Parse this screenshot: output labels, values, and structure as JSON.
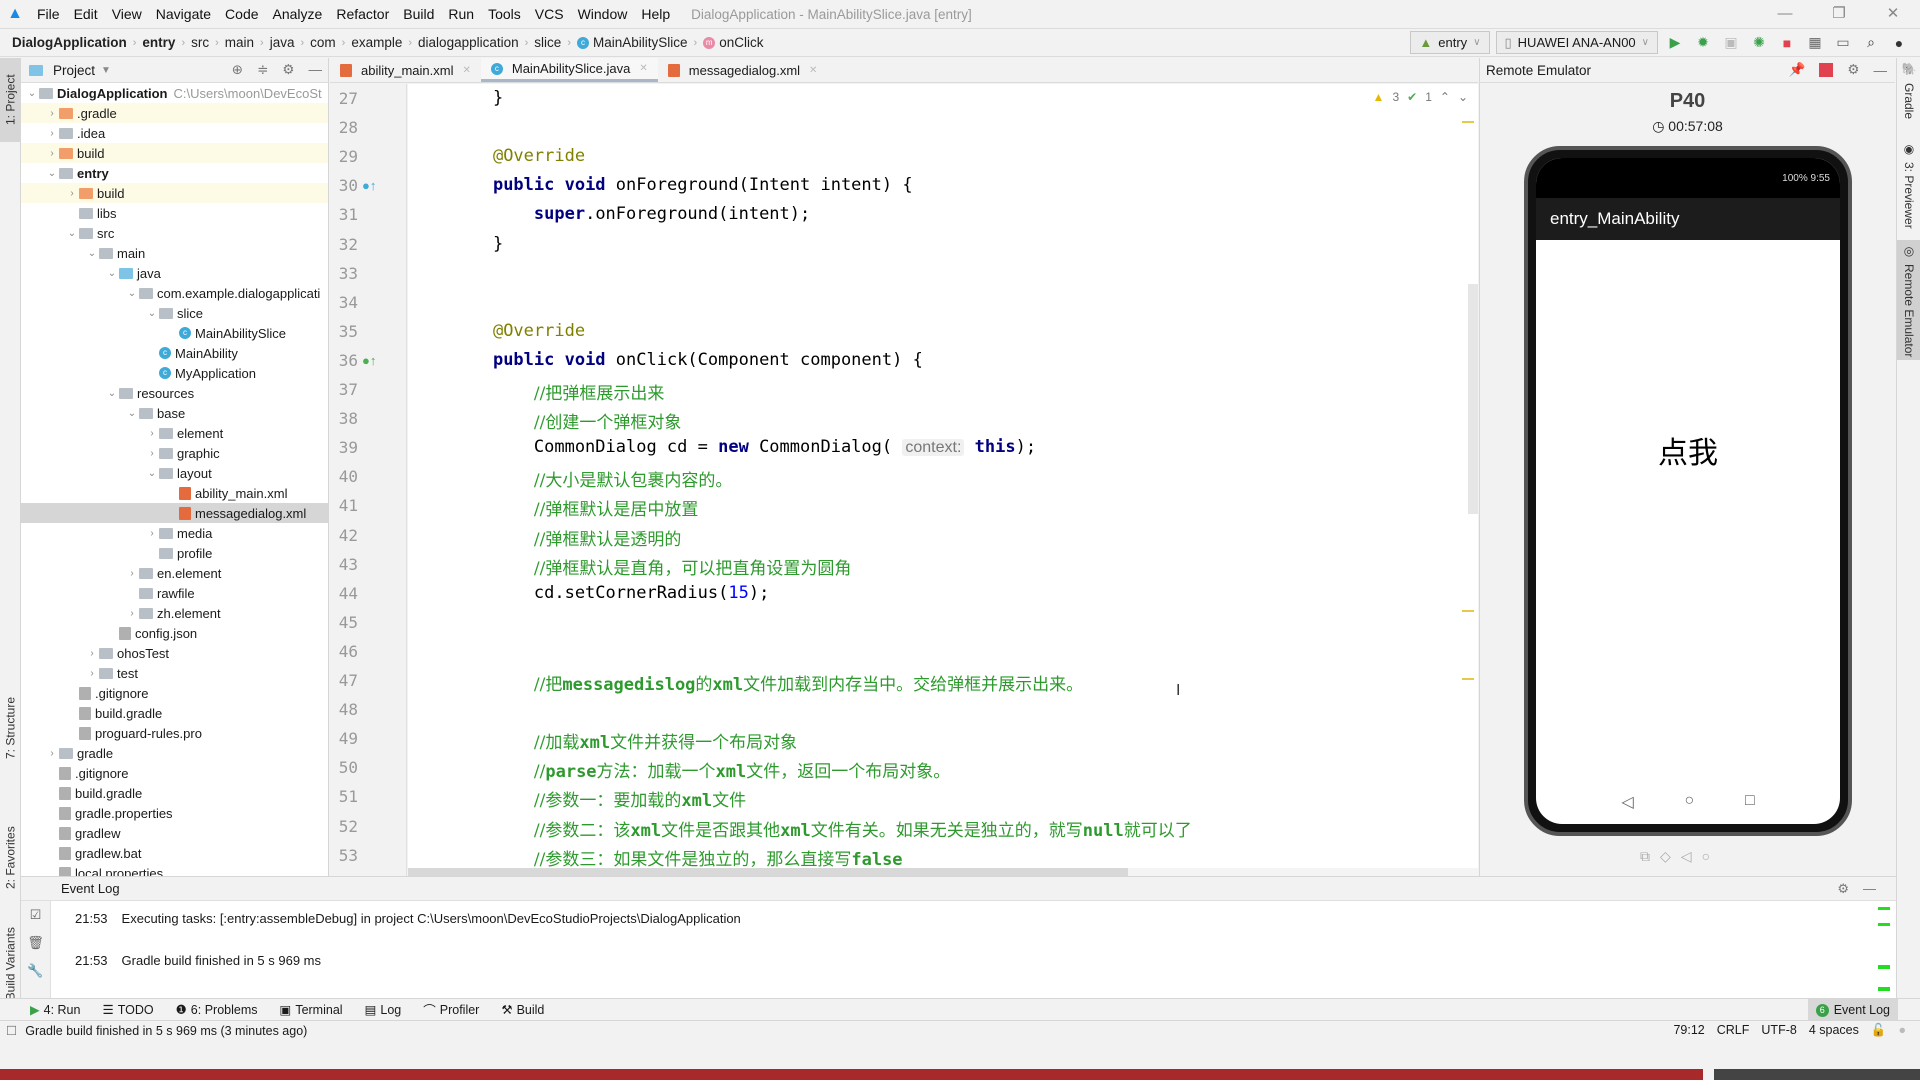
{
  "menu": {
    "items": [
      "File",
      "Edit",
      "View",
      "Navigate",
      "Code",
      "Analyze",
      "Refactor",
      "Build",
      "Run",
      "Tools",
      "VCS",
      "Window",
      "Help"
    ],
    "window_title": "DialogApplication - MainAbilitySlice.java [entry]"
  },
  "breadcrumb": [
    "DialogApplication",
    "entry",
    "src",
    "main",
    "java",
    "com",
    "example",
    "dialogapplication",
    "slice",
    "MainAbilitySlice",
    "onClick"
  ],
  "toolbar": {
    "config": "entry",
    "device": "HUAWEI ANA-AN00"
  },
  "project_panel": {
    "title": "Project",
    "tree": [
      {
        "label": "DialogApplication",
        "extra": "C:\\Users\\moon\\DevEcoSt",
        "depth": 0,
        "arrow": "v",
        "bold": true
      },
      {
        "label": ".gradle",
        "depth": 1,
        "arrow": ">",
        "folder": "o",
        "hl": true
      },
      {
        "label": ".idea",
        "depth": 1,
        "arrow": ">",
        "folder": "g"
      },
      {
        "label": "build",
        "depth": 1,
        "arrow": ">",
        "folder": "o",
        "hl": true
      },
      {
        "label": "entry",
        "depth": 1,
        "arrow": "v",
        "folder": "g",
        "bold": true
      },
      {
        "label": "build",
        "depth": 2,
        "arrow": ">",
        "folder": "o",
        "hl": true
      },
      {
        "label": "libs",
        "depth": 2,
        "arrow": "",
        "folder": "g"
      },
      {
        "label": "src",
        "depth": 2,
        "arrow": "v",
        "folder": "g"
      },
      {
        "label": "main",
        "depth": 3,
        "arrow": "v",
        "folder": "g"
      },
      {
        "label": "java",
        "depth": 4,
        "arrow": "v",
        "folder": "b"
      },
      {
        "label": "com.example.dialogapplicati",
        "depth": 5,
        "arrow": "v",
        "folder": "g"
      },
      {
        "label": "slice",
        "depth": 6,
        "arrow": "v",
        "folder": "g"
      },
      {
        "label": "MainAbilitySlice",
        "depth": 7,
        "arrow": "",
        "cls": true
      },
      {
        "label": "MainAbility",
        "depth": 6,
        "arrow": "",
        "cls": true
      },
      {
        "label": "MyApplication",
        "depth": 6,
        "arrow": "",
        "cls": true
      },
      {
        "label": "resources",
        "depth": 4,
        "arrow": "v",
        "folder": "g"
      },
      {
        "label": "base",
        "depth": 5,
        "arrow": "v",
        "folder": "g"
      },
      {
        "label": "element",
        "depth": 6,
        "arrow": ">",
        "folder": "g"
      },
      {
        "label": "graphic",
        "depth": 6,
        "arrow": ">",
        "folder": "g"
      },
      {
        "label": "layout",
        "depth": 6,
        "arrow": "v",
        "folder": "g"
      },
      {
        "label": "ability_main.xml",
        "depth": 7,
        "arrow": "",
        "xml": true
      },
      {
        "label": "messagedialog.xml",
        "depth": 7,
        "arrow": "",
        "xml": true,
        "sel": true
      },
      {
        "label": "media",
        "depth": 6,
        "arrow": ">",
        "folder": "g"
      },
      {
        "label": "profile",
        "depth": 6,
        "arrow": "",
        "folder": "g"
      },
      {
        "label": "en.element",
        "depth": 5,
        "arrow": ">",
        "folder": "g"
      },
      {
        "label": "rawfile",
        "depth": 5,
        "arrow": "",
        "folder": "g"
      },
      {
        "label": "zh.element",
        "depth": 5,
        "arrow": ">",
        "folder": "g"
      },
      {
        "label": "config.json",
        "depth": 4,
        "arrow": "",
        "doc": true
      },
      {
        "label": "ohosTest",
        "depth": 3,
        "arrow": ">",
        "folder": "g"
      },
      {
        "label": "test",
        "depth": 3,
        "arrow": ">",
        "folder": "g"
      },
      {
        "label": ".gitignore",
        "depth": 2,
        "arrow": "",
        "doc": true
      },
      {
        "label": "build.gradle",
        "depth": 2,
        "arrow": "",
        "doc": true
      },
      {
        "label": "proguard-rules.pro",
        "depth": 2,
        "arrow": "",
        "doc": true
      },
      {
        "label": "gradle",
        "depth": 1,
        "arrow": ">",
        "folder": "g"
      },
      {
        "label": ".gitignore",
        "depth": 1,
        "arrow": "",
        "doc": true
      },
      {
        "label": "build.gradle",
        "depth": 1,
        "arrow": "",
        "doc": true
      },
      {
        "label": "gradle.properties",
        "depth": 1,
        "arrow": "",
        "doc": true
      },
      {
        "label": "gradlew",
        "depth": 1,
        "arrow": "",
        "doc": true
      },
      {
        "label": "gradlew.bat",
        "depth": 1,
        "arrow": "",
        "doc": true
      },
      {
        "label": "local.properties",
        "depth": 1,
        "arrow": "",
        "doc": true
      }
    ]
  },
  "editor": {
    "tabs": [
      {
        "label": "ability_main.xml",
        "type": "xml",
        "active": false
      },
      {
        "label": "MainAbilitySlice.java",
        "type": "class",
        "active": true
      },
      {
        "label": "messagedialog.xml",
        "type": "xml",
        "active": false
      }
    ],
    "warnings": "3",
    "weak_warnings": "1",
    "lines": [
      {
        "n": "27",
        "html": "    }"
      },
      {
        "n": "28",
        "html": ""
      },
      {
        "n": "29",
        "html": "    <span class='an'>@Override</span>"
      },
      {
        "n": "30",
        "html": "    <span class='kw'>public void</span> onForeground(Intent intent) {"
      },
      {
        "n": "31",
        "html": "        <span class='kw'>super</span>.onForeground(intent);"
      },
      {
        "n": "32",
        "html": "    }"
      },
      {
        "n": "33",
        "html": ""
      },
      {
        "n": "34",
        "html": ""
      },
      {
        "n": "35",
        "html": "    <span class='an'>@Override</span>"
      },
      {
        "n": "36",
        "html": "    <span class='kw'>public void</span> onClick(Component component) {"
      },
      {
        "n": "37",
        "html": "        <span class='cm'>//把弹框展示出来</span>"
      },
      {
        "n": "38",
        "html": "        <span class='cm'>//创建一个弹框对象</span>"
      },
      {
        "n": "39",
        "html": "        CommonDialog cd = <span class='kw'>new</span> CommonDialog( <span class='hint'>context:</span> <span class='kw'>this</span>);"
      },
      {
        "n": "40",
        "html": "        <span class='cm'>//大小是默认包裹内容的。</span>"
      },
      {
        "n": "41",
        "html": "        <span class='cm'>//弹框默认是居中放置</span>"
      },
      {
        "n": "42",
        "html": "        <span class='cm'>//弹框默认是透明的</span>"
      },
      {
        "n": "43",
        "html": "        <span class='cm'>//弹框默认是直角，可以把直角设置为圆角</span>"
      },
      {
        "n": "44",
        "html": "        cd.setCornerRadius(<span class='num'>15</span>);"
      },
      {
        "n": "45",
        "html": ""
      },
      {
        "n": "46",
        "html": ""
      },
      {
        "n": "47",
        "html": "        <span class='cm'>//把<b>messagedislog</b>的<b>xml</b>文件加载到内存当中。交给弹框并展示出来。</span>"
      },
      {
        "n": "48",
        "html": ""
      },
      {
        "n": "49",
        "html": "        <span class='cm'>//加载<b>xml</b>文件并获得一个布局对象</span>"
      },
      {
        "n": "50",
        "html": "        <span class='cm'>//<b>parse</b>方法：加载一个<b>xml</b>文件，返回一个布局对象。</span>"
      },
      {
        "n": "51",
        "html": "        <span class='cm'>//参数一：要加载的<b>xml</b>文件</span>"
      },
      {
        "n": "52",
        "html": "        <span class='cm'>//参数二：该<b>xml</b>文件是否跟其他<b>xml</b>文件有关。如果无关是独立的，就写<b>null</b>就可以了</span>"
      },
      {
        "n": "53",
        "html": "        <span class='cm'>//参数三：如果文件是独立的，那么直接写<b>false</b></span>"
      }
    ]
  },
  "emulator": {
    "title": "Remote Emulator",
    "device": "P40",
    "timer": "00:57:08",
    "status_right": "100%  9:55",
    "app_title": "entry_MainAbility",
    "button_text": "点我"
  },
  "right_strip": [
    "Gradle",
    "3: Previewer",
    "Remote Emulator"
  ],
  "left_strip": [
    "1: Project",
    "7: Structure",
    "2: Favorites",
    "OhosBuild Variants"
  ],
  "event_log": {
    "title": "Event Log",
    "entries": [
      {
        "time": "21:53",
        "text": "Executing tasks: [:entry:assembleDebug] in project C:\\Users\\moon\\DevEcoStudioProjects\\DialogApplication"
      },
      {
        "time": "21:53",
        "text": "Gradle build finished in 5 s 969 ms"
      }
    ]
  },
  "tool_tabs": [
    "4: Run",
    "TODO",
    "6: Problems",
    "Terminal",
    "Log",
    "Profiler",
    "Build"
  ],
  "event_log_tab": {
    "badge": "6",
    "label": "Event Log"
  },
  "status_bar": {
    "message": "Gradle build finished in 5 s 969 ms (3 minutes ago)",
    "position": "79:12",
    "line_sep": "CRLF",
    "encoding": "UTF-8",
    "indent": "4 spaces"
  }
}
